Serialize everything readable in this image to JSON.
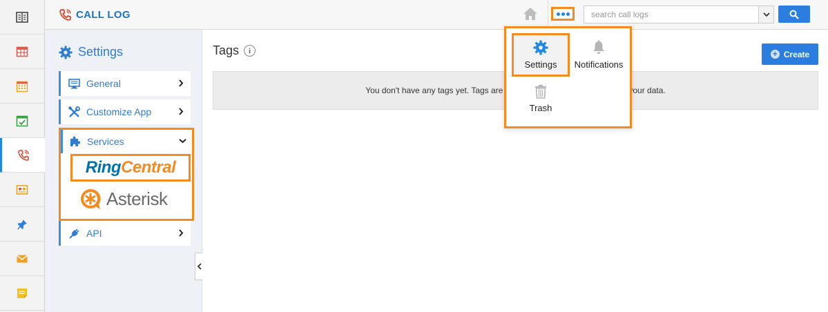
{
  "header": {
    "app_title": "CALL LOG",
    "search_placeholder": "search call logs"
  },
  "rail": {
    "items": [
      {
        "icon": "dashboard-icon",
        "color": "#444444"
      },
      {
        "icon": "table-icon",
        "color": "#e05a4e"
      },
      {
        "icon": "calendar-grid-icon",
        "color": "#f0a020"
      },
      {
        "icon": "calendar-check-icon",
        "color": "#3aa043"
      },
      {
        "icon": "phone-icon",
        "color": "#d9442c"
      },
      {
        "icon": "photo-board-icon",
        "color": "#f0a020"
      },
      {
        "icon": "pin-icon",
        "color": "#2b7de0"
      },
      {
        "icon": "mail-icon",
        "color": "#f0a020"
      },
      {
        "icon": "note-icon",
        "color": "#f0c020"
      }
    ]
  },
  "settings": {
    "title": "Settings",
    "nav": {
      "general": "General",
      "customize": "Customize App",
      "services": "Services",
      "api": "API"
    },
    "services": {
      "ringcentral_a": "Ring",
      "ringcentral_b": "Central",
      "asterisk": "Asterisk"
    }
  },
  "main": {
    "title": "Tags",
    "create_label": "Create",
    "empty_left": "You don't have any tags yet. Tags are a",
    "empty_right": "your data."
  },
  "dropdown": {
    "settings": "Settings",
    "notifications": "Notifications",
    "trash": "Trash"
  },
  "colors": {
    "accent": "#2b7de0",
    "highlight": "#f58a1f"
  }
}
